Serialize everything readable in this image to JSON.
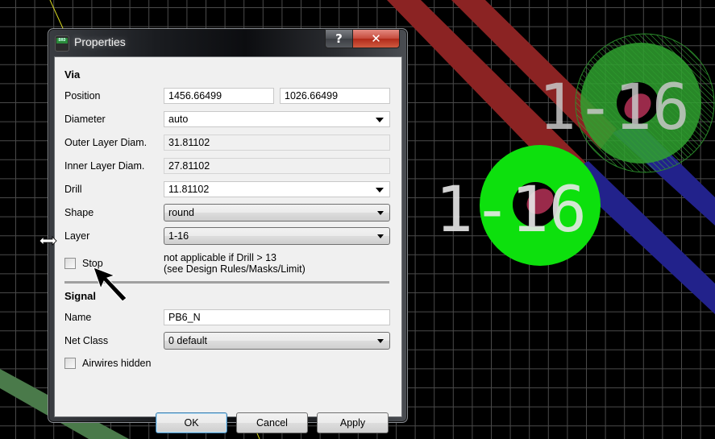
{
  "dialog": {
    "title": "Properties",
    "app_icon_label": "BRD",
    "help_button": "?",
    "close_button": "✕"
  },
  "via": {
    "section_title": "Via",
    "position_label": "Position",
    "position_x": "1456.66499",
    "position_y": "1026.66499",
    "diameter_label": "Diameter",
    "diameter_value": "auto",
    "outer_diam_label": "Outer Layer Diam.",
    "outer_diam_value": "31.81102",
    "inner_diam_label": "Inner Layer Diam.",
    "inner_diam_value": "27.81102",
    "drill_label": "Drill",
    "drill_value": "11.81102",
    "shape_label": "Shape",
    "shape_value": "round",
    "layer_label": "Layer",
    "layer_value": "1-16",
    "stop_label": "Stop",
    "stop_checked": false,
    "stop_note_line1": "not applicable if Drill > 13",
    "stop_note_line2": "(see Design Rules/Masks/Limit)"
  },
  "signal": {
    "section_title": "Signal",
    "name_label": "Name",
    "name_value": "PB6_N",
    "netclass_label": "Net Class",
    "netclass_value": "0 default",
    "airwires_label": "Airwires hidden",
    "airwires_checked": false
  },
  "buttons": {
    "ok": "OK",
    "cancel": "Cancel",
    "apply": "Apply"
  },
  "pcb": {
    "via_labels": [
      "1-16",
      "1-16"
    ],
    "colors": {
      "background": "#000000",
      "grid": "#4a4a4a",
      "top_trace": "#8b2323",
      "bottom_trace": "#22228b",
      "via_pad": "#0de00d",
      "via_drill": "#9a2a4a",
      "label": "#e0e0e0",
      "airwire": "#d8d820",
      "dim_trace": "#4a7a4a"
    }
  }
}
